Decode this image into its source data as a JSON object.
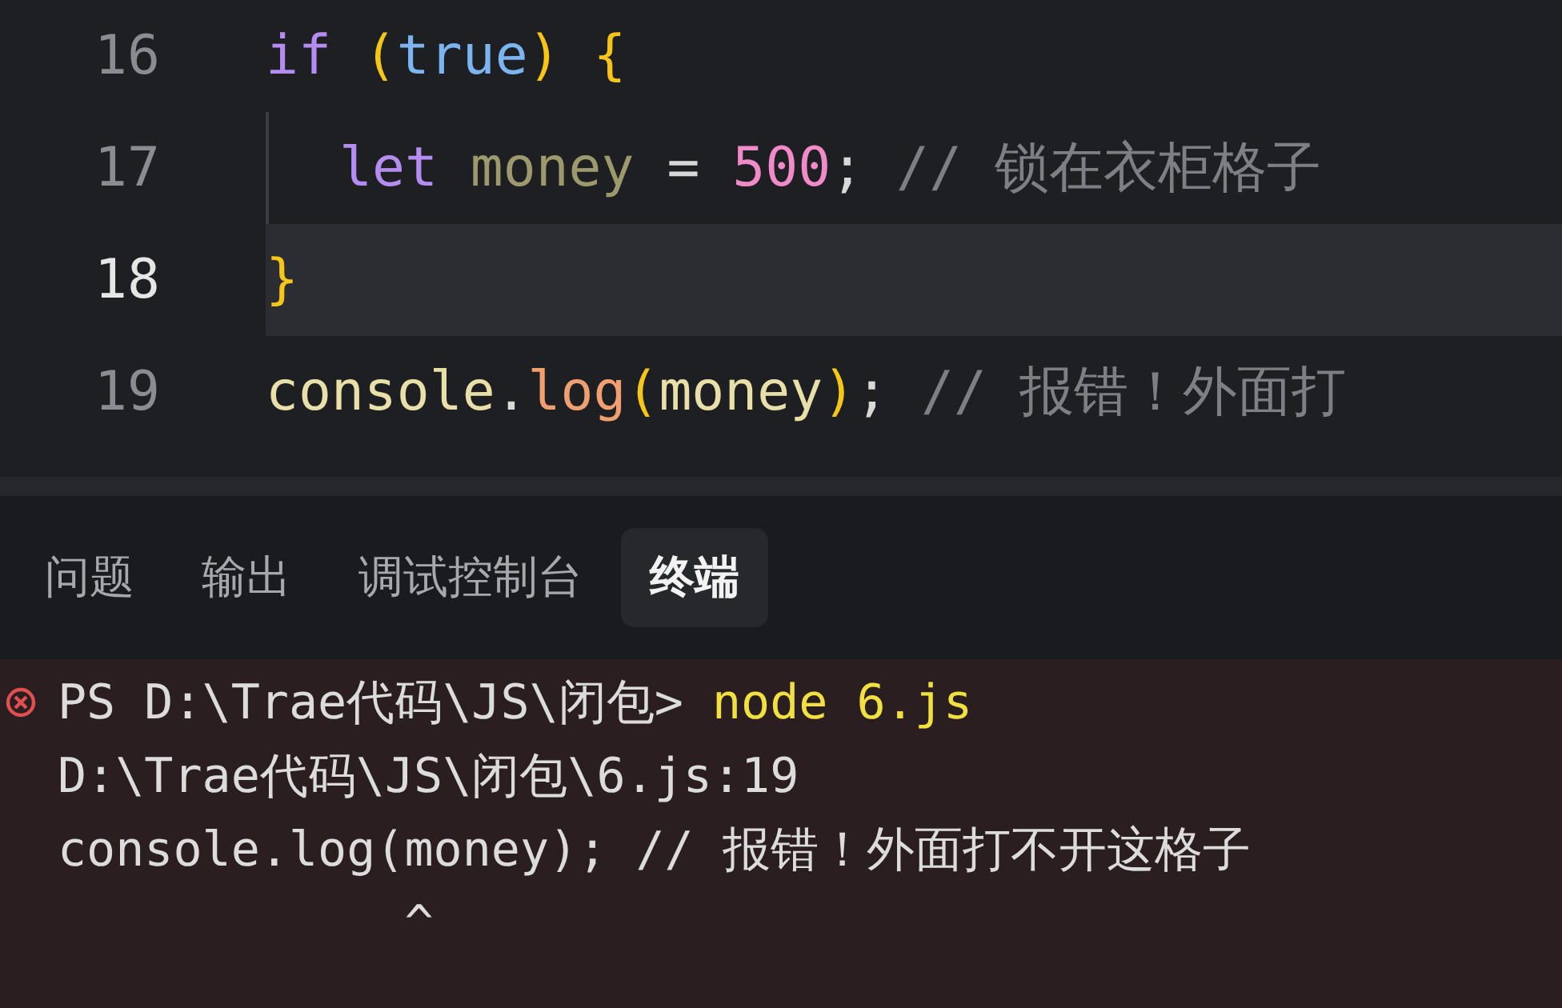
{
  "editor": {
    "lines": [
      {
        "number": "16",
        "current": false,
        "indented": false,
        "tokens": [
          {
            "kind": "keyword",
            "text": "if "
          },
          {
            "kind": "paren",
            "text": "("
          },
          {
            "kind": "boolean",
            "text": "true"
          },
          {
            "kind": "paren",
            "text": ") {"
          }
        ]
      },
      {
        "number": "17",
        "current": false,
        "indented": true,
        "tokens": [
          {
            "kind": "keyword",
            "text": "let "
          },
          {
            "kind": "variable",
            "text": "money"
          },
          {
            "kind": "plain",
            "text": " = "
          },
          {
            "kind": "number",
            "text": "500"
          },
          {
            "kind": "plain",
            "text": "; "
          },
          {
            "kind": "comment",
            "text": "// 锁在衣柜格子"
          }
        ]
      },
      {
        "number": "18",
        "current": true,
        "indented": false,
        "tokens": [
          {
            "kind": "paren",
            "text": "}"
          }
        ]
      },
      {
        "number": "19",
        "current": false,
        "indented": false,
        "tokens": [
          {
            "kind": "object",
            "text": "console"
          },
          {
            "kind": "plain",
            "text": "."
          },
          {
            "kind": "method",
            "text": "log"
          },
          {
            "kind": "paren",
            "text": "("
          },
          {
            "kind": "object",
            "text": "money"
          },
          {
            "kind": "paren",
            "text": ")"
          },
          {
            "kind": "plain",
            "text": "; "
          },
          {
            "kind": "comment",
            "text": "// 报错！外面打"
          }
        ]
      }
    ]
  },
  "panel": {
    "tabs": [
      {
        "label": "问题",
        "selected": false
      },
      {
        "label": "输出",
        "selected": false
      },
      {
        "label": "调试控制台",
        "selected": false
      },
      {
        "label": "终端",
        "selected": true
      }
    ]
  },
  "terminal": {
    "lines": [
      {
        "error": true,
        "segments": [
          {
            "kind": "prompt",
            "text": "PS D:\\Trae代码\\JS\\闭包> "
          },
          {
            "kind": "command",
            "text": "node 6.js"
          }
        ]
      },
      {
        "error": false,
        "segments": [
          {
            "kind": "output",
            "text": "D:\\Trae代码\\JS\\闭包\\6.js:19"
          }
        ]
      },
      {
        "error": false,
        "segments": [
          {
            "kind": "output",
            "text": "console.log(money); // 报错！外面打不开这格子"
          }
        ]
      },
      {
        "error": false,
        "segments": [
          {
            "kind": "output",
            "text": "            ^"
          }
        ]
      }
    ]
  }
}
